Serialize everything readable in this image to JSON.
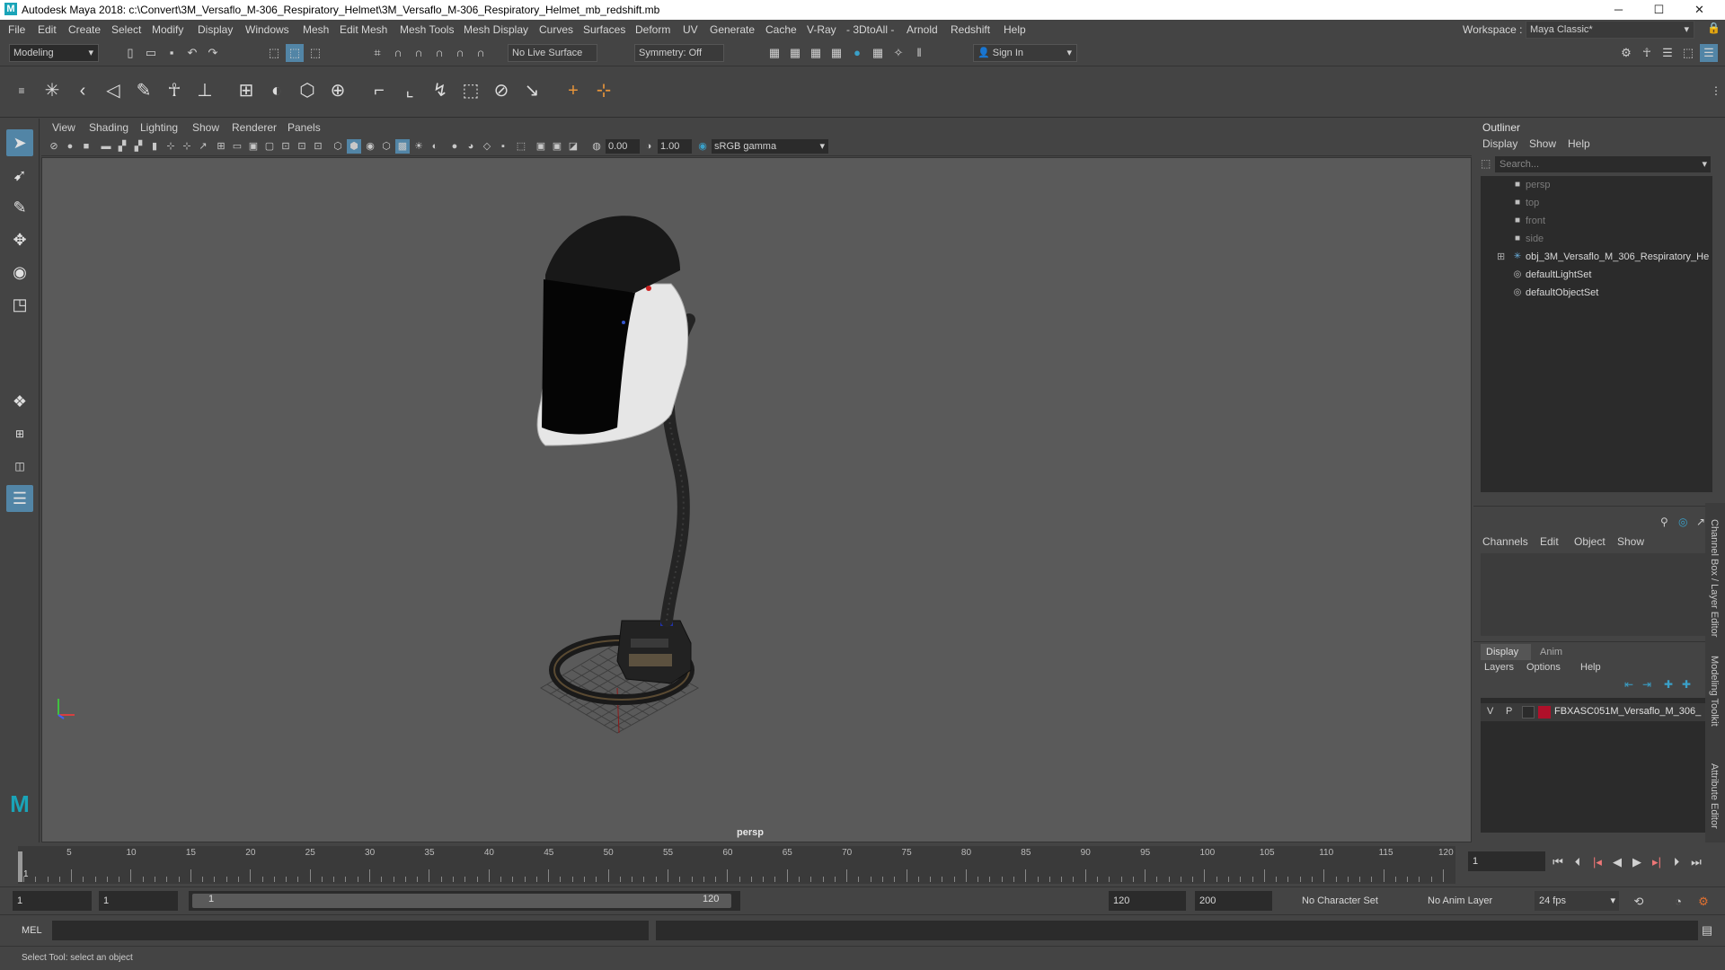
{
  "title_bar": {
    "app_icon": "M",
    "title": "Autodesk Maya 2018: c:\\Convert\\3M_Versaflo_M-306_Respiratory_Helmet\\3M_Versaflo_M-306_Respiratory_Helmet_mb_redshift.mb",
    "minimize": "─",
    "maximize": "☐",
    "close": "✕"
  },
  "menu_bar": {
    "items": [
      "File",
      "Edit",
      "Create",
      "Select",
      "Modify",
      "Display",
      "Windows",
      "Mesh",
      "Edit Mesh",
      "Mesh Tools",
      "Mesh Display",
      "Curves",
      "Surfaces",
      "Deform",
      "UV",
      "Generate",
      "Cache",
      "V-Ray",
      "- 3DtoAll -",
      "Arnold",
      "Redshift",
      "Help"
    ],
    "workspace_label": "Workspace :",
    "workspace_value": "Maya Classic*"
  },
  "status_line": {
    "menu_set": "Modeling",
    "live_surface": "No Live Surface",
    "symmetry": "Symmetry: Off",
    "sign_in": "Sign In"
  },
  "viewport": {
    "menus": [
      "View",
      "Shading",
      "Lighting",
      "Show",
      "Renderer",
      "Panels"
    ],
    "exposure": "0.00",
    "gamma": "1.00",
    "color_space": "sRGB gamma",
    "camera": "persp"
  },
  "outliner": {
    "title": "Outliner",
    "menus": [
      "Display",
      "Show",
      "Help"
    ],
    "search_placeholder": "Search...",
    "items": [
      {
        "label": "persp",
        "dim": true,
        "icon": "camera-icon"
      },
      {
        "label": "top",
        "dim": true,
        "icon": "camera-icon"
      },
      {
        "label": "front",
        "dim": true,
        "icon": "camera-icon"
      },
      {
        "label": "side",
        "dim": true,
        "icon": "camera-icon"
      },
      {
        "label": "obj_3M_Versaflo_M_306_Respiratory_He",
        "dim": false,
        "icon": "transform-icon"
      },
      {
        "label": "defaultLightSet",
        "dim": false,
        "icon": "set-icon"
      },
      {
        "label": "defaultObjectSet",
        "dim": false,
        "icon": "set-icon"
      }
    ]
  },
  "channel_box": {
    "menus": [
      "Channels",
      "Edit",
      "Object",
      "Show"
    ]
  },
  "layer_editor": {
    "tabs": [
      "Display",
      "Anim"
    ],
    "menus": [
      "Layers",
      "Options",
      "Help"
    ],
    "layer": {
      "v": "V",
      "p": "P",
      "color": "#b0102a",
      "name": "FBXASC051M_Versaflo_M_306_"
    }
  },
  "side_tabs": [
    "Channel Box / Layer Editor",
    "Modeling Toolkit",
    "Attribute Editor"
  ],
  "time_slider": {
    "labels": [
      "5",
      "10",
      "15",
      "20",
      "25",
      "30",
      "35",
      "40",
      "45",
      "50",
      "55",
      "60",
      "65",
      "70",
      "75",
      "80",
      "85",
      "90",
      "95",
      "100",
      "105",
      "110",
      "115",
      "120"
    ],
    "current_marker": "1",
    "current_frame": "1"
  },
  "range_slider": {
    "start": "1",
    "playback_start": "1",
    "range_start": "1",
    "range_end": "120",
    "playback_end": "120",
    "end": "200",
    "character_set": "No Character Set",
    "anim_layer": "No Anim Layer",
    "fps": "24 fps"
  },
  "command_line": {
    "label": "MEL"
  },
  "help_line": {
    "text": "Select Tool: select an object"
  }
}
